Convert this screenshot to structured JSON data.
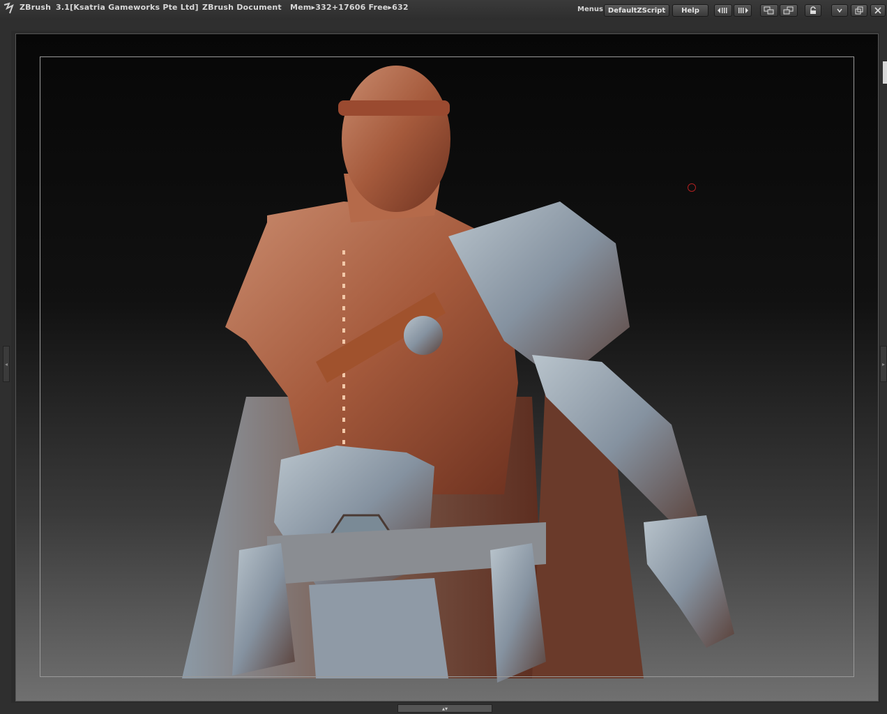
{
  "titlebar": {
    "app": "ZBrush",
    "version": "3.1[Ksatria Gameworks Pte Ltd]",
    "document": "ZBrush Document",
    "mem": "Mem▸332+17606 Free▸632"
  },
  "toolbar": {
    "menus_label": "Menus",
    "script_label": "DefaultZScript",
    "help_label": "Help"
  },
  "icons": {
    "logo": "zbrush-logo-icon",
    "close": "close-icon"
  },
  "colors": {
    "ui_gray": "#2f2f2f",
    "title_text": "#d8d8d8",
    "cursor_ring": "#b02020",
    "doc_border": "#9a9a9a"
  }
}
